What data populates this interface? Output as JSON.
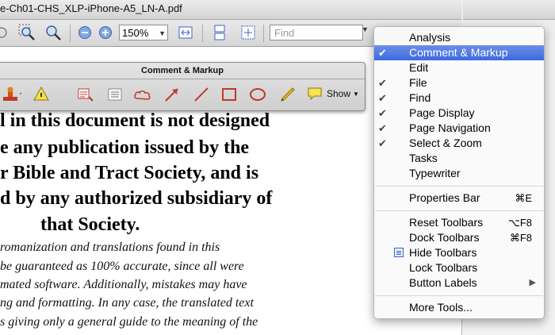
{
  "window": {
    "title": "e-Ch01-CHS_XLP-iPhone-A5_LN-A.pdf"
  },
  "toolbar": {
    "zoom_value": "150%",
    "find_placeholder": "Find"
  },
  "comment_panel": {
    "title": "Comment & Markup",
    "show_label": "Show"
  },
  "document": {
    "heading_lines": [
      "l in this document is not designed",
      "e any publication issued by the",
      "r Bible and Tract Society, and is",
      "d by any authorized subsidiary of",
      "that Society."
    ],
    "body_lines": [
      "romanization  and  translations  found in  this",
      "be guaranteed as 100% accurate, since all were",
      "mated software.  Additionally, mistakes may have",
      "ng and formatting.   In any case, the translated text",
      "s giving only a general guide to the meaning of the"
    ]
  },
  "menu": {
    "items": [
      {
        "label": "Analysis",
        "checked": false
      },
      {
        "label": "Comment & Markup",
        "checked": true
      },
      {
        "label": "Edit",
        "checked": false
      },
      {
        "label": "File",
        "checked": true
      },
      {
        "label": "Find",
        "checked": true
      },
      {
        "label": "Page Display",
        "checked": true
      },
      {
        "label": "Page Navigation",
        "checked": true
      },
      {
        "label": "Select & Zoom",
        "checked": true
      },
      {
        "label": "Tasks",
        "checked": false
      },
      {
        "label": "Typewriter",
        "checked": false
      },
      {
        "label": "Properties Bar",
        "shortcut": "⌘E"
      },
      {
        "label": "Reset Toolbars",
        "shortcut": "⌥F8"
      },
      {
        "label": "Dock Toolbars",
        "shortcut": "⌘F8"
      },
      {
        "label": "Hide Toolbars"
      },
      {
        "label": "Lock Toolbars"
      },
      {
        "label": "Button Labels"
      },
      {
        "label": "More Tools..."
      }
    ],
    "check_glyph": "✔",
    "submenu_glyph": "▶"
  },
  "colors": {
    "menu_highlight": "#3d69df",
    "check": "#444444"
  }
}
